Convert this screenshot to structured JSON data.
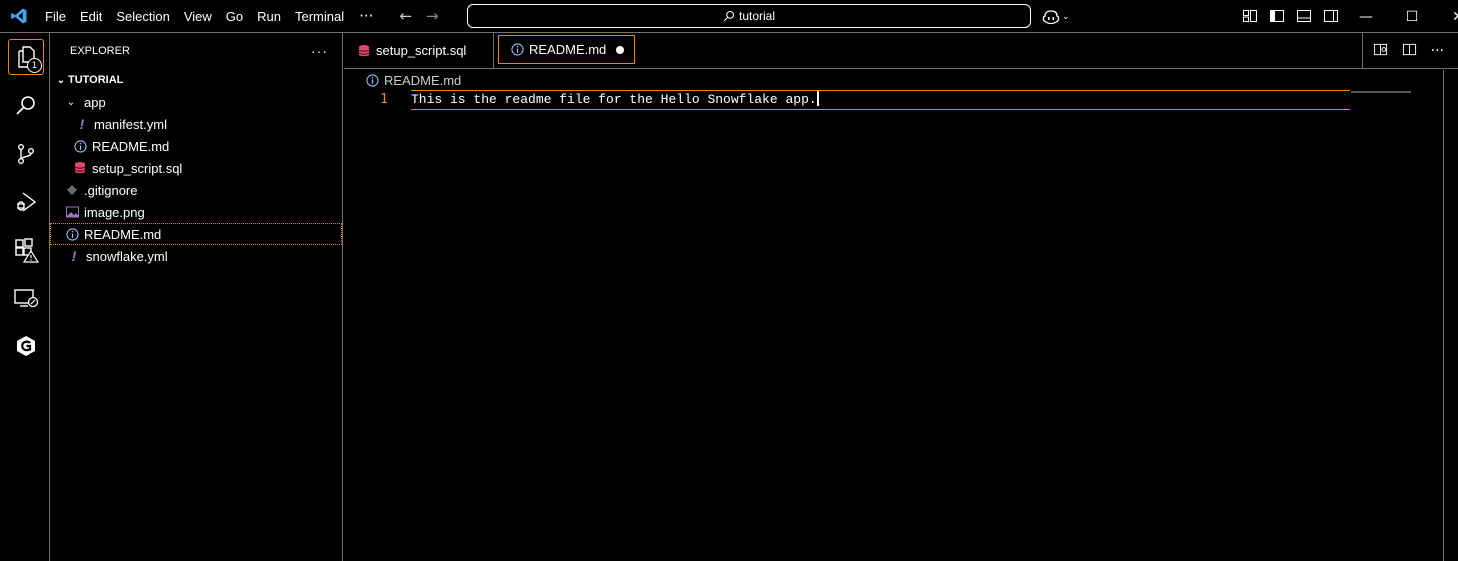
{
  "menu": [
    "File",
    "Edit",
    "Selection",
    "View",
    "Go",
    "Run",
    "Terminal"
  ],
  "menu_more": "···",
  "search": {
    "text": "tutorial"
  },
  "activity": {
    "explorer_badge": "1"
  },
  "explorer": {
    "title": "EXPLORER",
    "more": "···",
    "root": "TUTORIAL",
    "folder": "app",
    "items": [
      {
        "name": "manifest.yml"
      },
      {
        "name": "README.md"
      },
      {
        "name": "setup_script.sql"
      },
      {
        "name": ".gitignore"
      },
      {
        "name": "image.png"
      },
      {
        "name": "README.md"
      },
      {
        "name": "snowflake.yml"
      }
    ]
  },
  "tabs": [
    {
      "label": "setup_script.sql"
    },
    {
      "label": "README.md"
    }
  ],
  "breadcrumb": "README.md",
  "editor": {
    "line_number": "1",
    "line_text": "This is the readme file for the Hello Snowflake app."
  },
  "colors": {
    "focus": "#f38518",
    "border": "#6f6f6f",
    "sql": "#e8446b",
    "yml": "#a074c4",
    "info": "#9cc6ff"
  }
}
